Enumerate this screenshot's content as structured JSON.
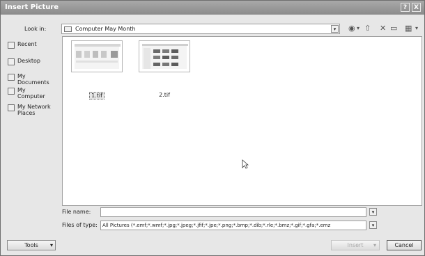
{
  "window": {
    "title": "Insert Picture",
    "help_label": "?",
    "close_label": "X"
  },
  "lookin": {
    "label": "Look in:",
    "value": "Computer May Month",
    "dropdown_glyph": "▾"
  },
  "toolbar": {
    "back_icon": "back-arrow-icon",
    "up_icon": "up-folder-icon",
    "delete_icon": "delete-icon",
    "new_folder_icon": "new-folder-icon",
    "views_icon": "views-icon"
  },
  "places": [
    {
      "label": "Recent"
    },
    {
      "label": "Desktop"
    },
    {
      "label": "My\nDocuments"
    },
    {
      "label": "My\nComputer"
    },
    {
      "label": "My Network\nPlaces"
    }
  ],
  "files": [
    {
      "name": "1.tif",
      "selected": true
    },
    {
      "name": "2.tif",
      "selected": false
    }
  ],
  "filename": {
    "label": "File name:",
    "value": ""
  },
  "filetype": {
    "label": "Files of type:",
    "value": "All Pictures (*.emf;*.wmf;*.jpg;*.jpeg;*.jfif;*.jpe;*.png;*.bmp;*.dib;*.rle;*.bmz;*.gif;*.gfa;*.emz"
  },
  "buttons": {
    "tools": "Tools",
    "insert": "Insert",
    "cancel": "Cancel"
  },
  "colors": {
    "titlebar": "#9a9a9a",
    "background": "#e7e7e7"
  }
}
